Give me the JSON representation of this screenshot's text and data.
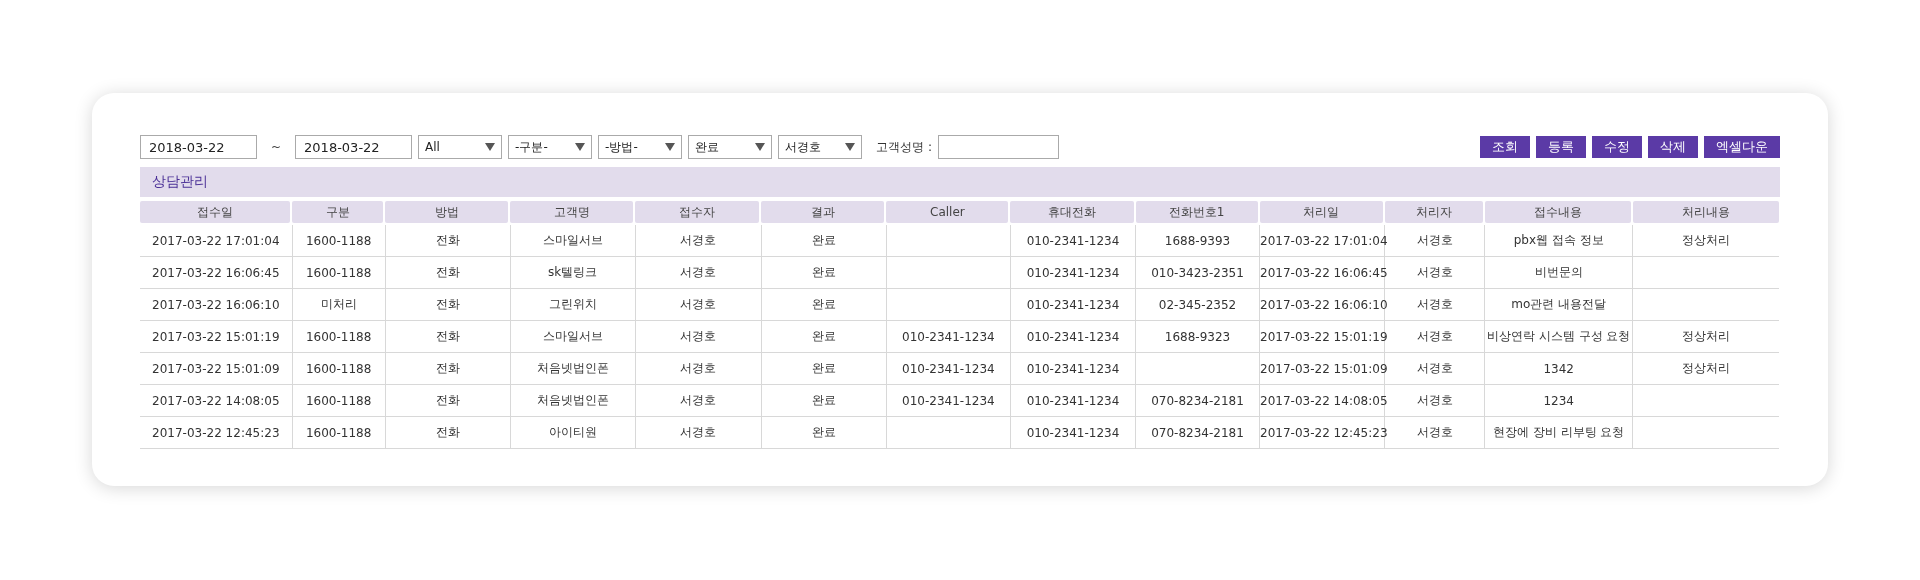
{
  "filters": {
    "date_from": "2018-03-22",
    "date_separator": "~",
    "date_to": "2018-03-22",
    "selects": [
      {
        "value": "All"
      },
      {
        "value": "-구분-"
      },
      {
        "value": "-방법-"
      },
      {
        "value": "완료"
      },
      {
        "value": "서경호"
      }
    ],
    "customer_label": "고객성명 :"
  },
  "buttons": [
    "조회",
    "등록",
    "수정",
    "삭제",
    "엑셀다운"
  ],
  "panel_title": "상담관리",
  "table": {
    "columns": [
      "접수일",
      "구분",
      "방법",
      "고객명",
      "접수자",
      "결과",
      "Caller",
      "휴대전화",
      "전화번호1",
      "처리일",
      "처리자",
      "접수내용",
      "처리내용"
    ],
    "rows": [
      [
        "2017-03-22 17:01:04",
        "1600-1188",
        "전화",
        "스마일서브",
        "서경호",
        "완료",
        null,
        "010-2341-1234",
        "1688-9393",
        "2017-03-22 17:01:04",
        "서경호",
        "pbx웹 접속 정보",
        "정상처리"
      ],
      [
        "2017-03-22 16:06:45",
        "1600-1188",
        "전화",
        "sk텔링크",
        "서경호",
        "완료",
        null,
        "010-2341-1234",
        "010-3423-2351",
        "2017-03-22 16:06:45",
        "서경호",
        "비번문의",
        null
      ],
      [
        "2017-03-22 16:06:10",
        "미처리",
        "전화",
        "그린위치",
        "서경호",
        "완료",
        null,
        "010-2341-1234",
        "02-345-2352",
        "2017-03-22 16:06:10",
        "서경호",
        "mo관련 내용전달",
        null
      ],
      [
        "2017-03-22 15:01:19",
        "1600-1188",
        "전화",
        "스마일서브",
        "서경호",
        "완료",
        "010-2341-1234",
        "010-2341-1234",
        "1688-9323",
        "2017-03-22 15:01:19",
        "서경호",
        "비상연락 시스템 구성 요청",
        "정상처리"
      ],
      [
        "2017-03-22 15:01:09",
        "1600-1188",
        "전화",
        "처음넷법인폰",
        "서경호",
        "완료",
        "010-2341-1234",
        "010-2341-1234",
        null,
        "2017-03-22 15:01:09",
        "서경호",
        "1342",
        "정상처리"
      ],
      [
        "2017-03-22 14:08:05",
        "1600-1188",
        "전화",
        "처음넷법인폰",
        "서경호",
        "완료",
        "010-2341-1234",
        "010-2341-1234",
        "070-8234-2181",
        "2017-03-22 14:08:05",
        "서경호",
        "1234",
        null
      ],
      [
        "2017-03-22 12:45:23",
        "1600-1188",
        "전화",
        "아이티원",
        "서경호",
        "완료",
        null,
        "010-2341-1234",
        "070-8234-2181",
        "2017-03-22 12:45:23",
        "서경호",
        "현장에 장비 리부팅 요청",
        null
      ]
    ]
  }
}
